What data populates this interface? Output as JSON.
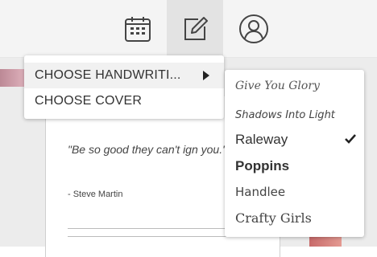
{
  "toolbar": {
    "buttons": [
      {
        "icon": "calendar-icon",
        "active": false
      },
      {
        "icon": "edit-icon",
        "active": true
      },
      {
        "icon": "user-icon",
        "active": false
      }
    ]
  },
  "document": {
    "quote": "\"Be so good they can't ign you.\"",
    "author": "- Steve Martin"
  },
  "menu": {
    "items": [
      {
        "label": "CHOOSE HANDWRITI...",
        "has_submenu": true,
        "highlighted": true
      },
      {
        "label": "CHOOSE COVER",
        "has_submenu": false,
        "highlighted": false
      }
    ]
  },
  "fonts_submenu": {
    "items": [
      {
        "label": "Give You Glory",
        "checked": false
      },
      {
        "label": "Shadows Into Light",
        "checked": false
      },
      {
        "label": "Raleway",
        "checked": true
      },
      {
        "label": "Poppins",
        "checked": false
      },
      {
        "label": "Handlee",
        "checked": false
      },
      {
        "label": "Crafty Girls",
        "checked": false
      }
    ]
  },
  "colors": {
    "toolbar_bg": "#f4f4f4",
    "active_button_bg": "#e3e3e3",
    "icon_color": "#444444"
  }
}
